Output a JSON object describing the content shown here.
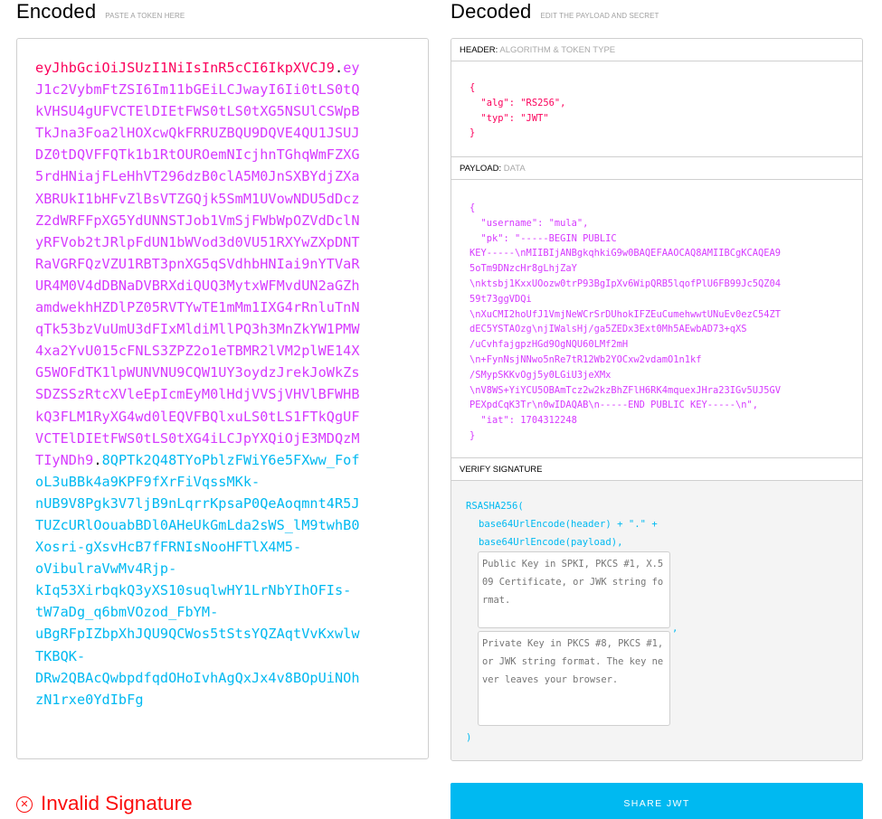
{
  "encoded": {
    "title": "Encoded",
    "subtitle": "PASTE A TOKEN HERE",
    "lines": [
      [
        {
          "t": "eyJhbGciOiJSUzI1NiIsInR5cCI6IkpXVCJ9",
          "c": "header"
        },
        {
          "t": ".",
          "c": "dot"
        },
        {
          "t": "ey",
          "c": "payload"
        }
      ],
      [
        {
          "t": "J1c2VybmFtZSI6Im11bGEiLCJwayI6Ii0tLS0tQ",
          "c": "payload"
        }
      ],
      [
        {
          "t": "kVHSU4gUFVCTElDIEtFWS0tLS0tXG5NSUlCSWpB",
          "c": "payload"
        }
      ],
      [
        {
          "t": "TkJna3Foa2lHOXcwQkFRRUZBQU9DQVE4QU1JSUJ",
          "c": "payload"
        }
      ],
      [
        {
          "t": "DZ0tDQVFFQTk1b1RtOUROemNIcjhnTGhqWmFZXG",
          "c": "payload"
        }
      ],
      [
        {
          "t": "5rdHNiajFLeHhVT296dzB0clA5M0JnSXBYdjZXa",
          "c": "payload"
        }
      ],
      [
        {
          "t": "XBRUkI1bHFvZlBsVTZGQjk5SmM1UVowNDU5dDcz",
          "c": "payload"
        }
      ],
      [
        {
          "t": "Z2dWRFFpXG5YdUNNSTJob1VmSjFWbWpOZVdDclN",
          "c": "payload"
        }
      ],
      [
        {
          "t": "yRFVob2tJRlpFdUN1bWVod3d0VU51RXYwZXpDNT",
          "c": "payload"
        }
      ],
      [
        {
          "t": "RaVGRFQzVZU1RBT3pnXG5qSVdhbHNIai9nYTVaR",
          "c": "payload"
        }
      ],
      [
        {
          "t": "UR4M0V4dDBNaDVBRXdiQUQ3MytxWFMvdUN2aGZh",
          "c": "payload"
        }
      ],
      [
        {
          "t": "amdwekhHZDlPZ05RVTYwTE1mMm1IXG4rRnluTnN",
          "c": "payload"
        }
      ],
      [
        {
          "t": "qTk53bzVuUmU3dFIxMldiMllPQ3h3MnZkYW1PMW",
          "c": "payload"
        }
      ],
      [
        {
          "t": "4xa2YvU015cFNLS3ZPZ2o1eTBMR2lVM2plWE14X",
          "c": "payload"
        }
      ],
      [
        {
          "t": "G5WOFdTK1lpWUNVNU9CQW1UY3oydzJrekJoWkZs",
          "c": "payload"
        }
      ],
      [
        {
          "t": "SDZSSzRtcXVleEpIcmEyM0lHdjVVSjVHVlBFWHB",
          "c": "payload"
        }
      ],
      [
        {
          "t": "kQ3FLM1RyXG4wd0lEQVFBQlxuLS0tLS1FTkQgUF",
          "c": "payload"
        }
      ],
      [
        {
          "t": "VCTElDIEtFWS0tLS0tXG4iLCJpYXQiOjE3MDQzM",
          "c": "payload"
        }
      ],
      [
        {
          "t": "TIyNDh9",
          "c": "payload"
        },
        {
          "t": ".",
          "c": "dot"
        },
        {
          "t": "8QPTk2Q48TYoPblzFWiY6e5FXww_Fof",
          "c": "sig"
        }
      ],
      [
        {
          "t": "oL3uBBk4a9KPF9fXrFiVqssMKk-",
          "c": "sig"
        }
      ],
      [
        {
          "t": "nUB9V8Pgk3V7ljB9nLqrrKpsaP0QeAoqmnt4R5J",
          "c": "sig"
        }
      ],
      [
        {
          "t": "TUZcURlOouabBDl0AHeUkGmLda2sWS_lM9twhB0",
          "c": "sig"
        }
      ],
      [
        {
          "t": "Xosri-gXsvHcB7fFRNIsNooHFTlX4M5-",
          "c": "sig"
        }
      ],
      [
        {
          "t": "oVibulraVwMv4Rjp-",
          "c": "sig"
        }
      ],
      [
        {
          "t": "kIq53XirbqkQ3yXS10suqlwHY1LrNbYIhOFIs-",
          "c": "sig"
        }
      ],
      [
        {
          "t": "tW7aDg_q6bmVOzod_FbYM-",
          "c": "sig"
        }
      ],
      [
        {
          "t": "uBgRFpIZbpXhJQU9QCWos5tStsYQZAqtVvKxwlw",
          "c": "sig"
        }
      ],
      [
        {
          "t": "TKBQK-",
          "c": "sig"
        }
      ],
      [
        {
          "t": "DRw2QBAcQwbpdfqdOHoIvhAgQxJx4v8BOpUiNOh",
          "c": "sig"
        }
      ],
      [
        {
          "t": "zN1rxe0YdIbFg",
          "c": "sig"
        }
      ]
    ]
  },
  "decoded": {
    "title": "Decoded",
    "subtitle": "EDIT THE PAYLOAD AND SECRET",
    "header_section": {
      "label": "HEADER:",
      "sublabel": "ALGORITHM & TOKEN TYPE",
      "json_text": "{\n  \"alg\": \"RS256\",\n  \"typ\": \"JWT\"\n}"
    },
    "payload_section": {
      "label": "PAYLOAD:",
      "sublabel": "DATA",
      "json_text": "{\n  \"username\": \"mula\",\n  \"pk\": \"-----BEGIN PUBLIC\nKEY-----\\nMIIBIjANBgkqhkiG9w0BAQEFAAOCAQ8AMIIBCgKCAQEA9\n5oTm9DNzcHr8gLhjZaY\n\\nktsbj1KxxUOozw0trP93BgIpXv6WipQRB5lqofPlU6FB99Jc5QZ04\n59t73ggVDQi\n\\nXuCMI2hoUfJ1VmjNeWCrSrDUhokIFZEuCumehwwtUNuEv0ezC54ZT\ndEC5YSTAOzg\\njIWalsHj/ga5ZEDx3Ext0Mh5AEwbAD73+qXS\n/uCvhfajgpzHGd9OgNQU60LMf2mH\n\\n+FynNsjNNwo5nRe7tR12Wb2YOCxw2vdamO1n1kf\n/SMypSKKvOgj5y0LGiU3jeXMx\n\\nV8WS+YiYCU5OBAmTcz2w2kzBhZFlH6RK4mquexJHra23IGv5UJ5GV\nPEXpdCqK3Tr\\n0wIDAQAB\\n-----END PUBLIC KEY-----\\n\",\n  \"iat\": 1704312248\n}"
    },
    "verify_section": {
      "label": "VERIFY SIGNATURE",
      "func_open": "RSASHA256(",
      "line1": "base64UrlEncode(header) + \".\" +",
      "line2": "base64UrlEncode(payload),",
      "public_key_placeholder": "Public Key in SPKI, PKCS #1, X.509 Certificate, or JWK string format.",
      "public_key_value": "",
      "private_key_placeholder": "Private Key in PKCS #8, PKCS #1, or JWK string format. The key never leaves your browser.",
      "private_key_value": "",
      "comma": ",",
      "func_close": ")"
    }
  },
  "footer": {
    "status_icon": "circle-x-icon",
    "status_icon_glyph": "✕",
    "status_text": "Invalid Signature",
    "share_label": "SHARE JWT"
  },
  "colors": {
    "header": "#fb015b",
    "payload": "#d63aff",
    "signature": "#00b9f1",
    "invalid": "#fb0d0d",
    "share_button": "#00b9f1"
  }
}
